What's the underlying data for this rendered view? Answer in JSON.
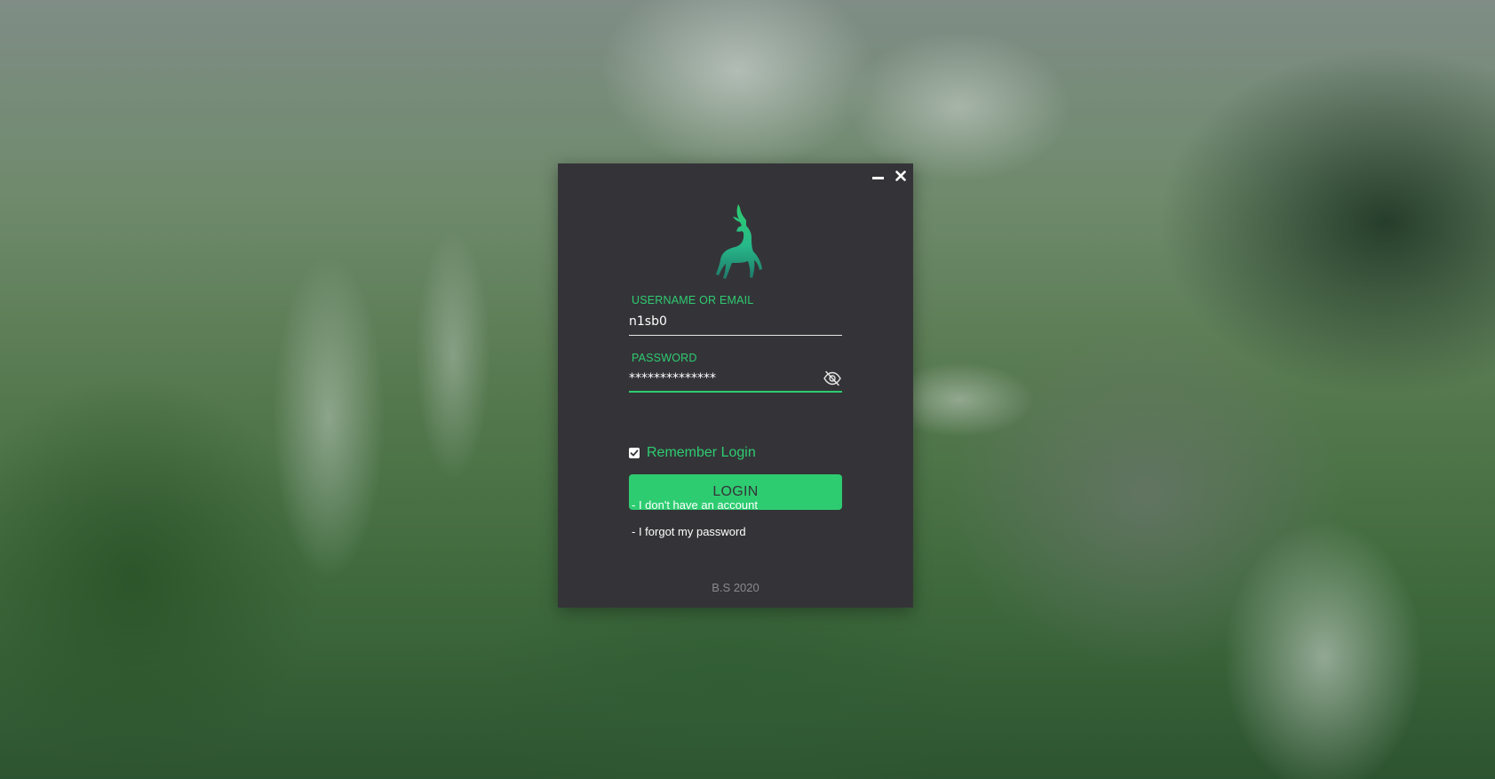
{
  "window": {
    "minimize_icon": "minimize-icon",
    "close_icon": "close-icon",
    "logo_icon": "deer-logo-icon"
  },
  "form": {
    "username_label": "USERNAME OR EMAIL",
    "username_value": "n1sb0",
    "password_label": "PASSWORD",
    "password_value": "**************",
    "password_toggle_icon": "eye-slash-icon",
    "remember_label": "Remember Login",
    "remember_checked": true,
    "login_label": "LOGIN",
    "no_account_link": "- I don't have an account",
    "forgot_password_link": "- I forgot my password"
  },
  "footer": {
    "text": "B.S 2020"
  },
  "colors": {
    "accent": "#2ecc71",
    "panel_bg": "#343438",
    "footer_text": "#8a8a8e"
  }
}
